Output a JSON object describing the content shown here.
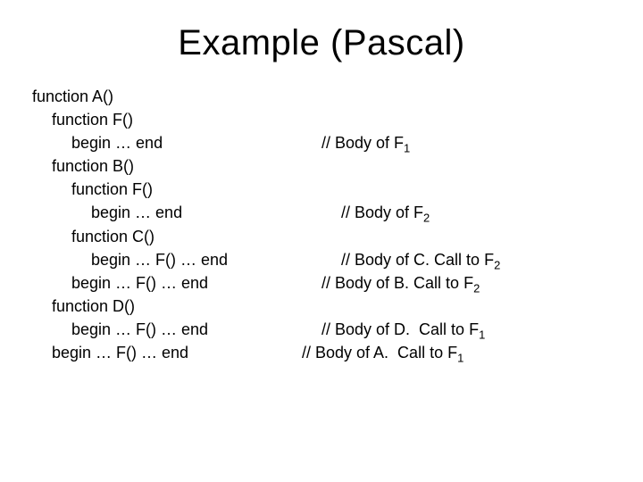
{
  "title": "Example (Pascal)",
  "lines": {
    "l1": {
      "code": "function A()",
      "comment": ""
    },
    "l2": {
      "code": "function F()",
      "comment": ""
    },
    "l3": {
      "code": "begin … end",
      "comment_prefix": "// Body of F",
      "comment_sub": "1"
    },
    "l4": {
      "code": "function B()",
      "comment": ""
    },
    "l5": {
      "code": "function F()",
      "comment": ""
    },
    "l6": {
      "code": "begin … end",
      "comment_prefix": "// Body of F",
      "comment_sub": "2"
    },
    "l7": {
      "code": "function C()",
      "comment": ""
    },
    "l8": {
      "code": "begin … F() … end",
      "comment_prefix": "// Body of C. Call to F",
      "comment_sub": "2"
    },
    "l9": {
      "code": "begin … F() … end",
      "comment_prefix": "// Body of B. Call to F",
      "comment_sub": "2"
    },
    "l10": {
      "code": "function D()",
      "comment": ""
    },
    "l11": {
      "code": "begin … F() … end",
      "comment_prefix": "// Body of D.  Call to F",
      "comment_sub": "1"
    },
    "l12": {
      "code": "begin … F() … end",
      "comment_prefix": "// Body of A.  Call to F",
      "comment_sub": "1"
    }
  }
}
